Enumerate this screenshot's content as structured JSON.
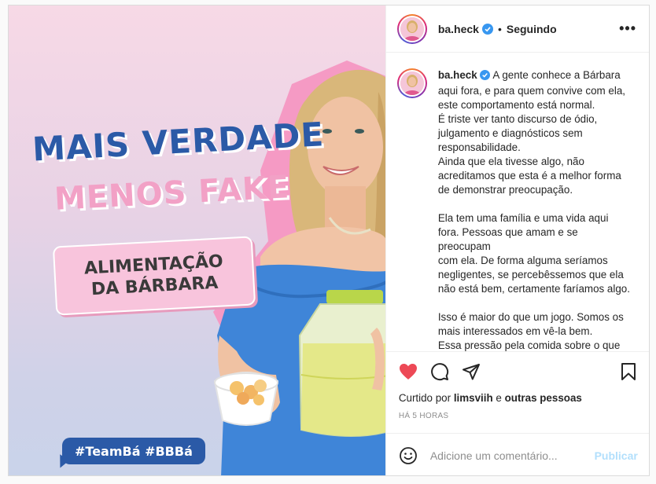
{
  "media": {
    "headline_1": "MAIS VERDADE",
    "headline_2": "MENOS FAKE",
    "box_line_1": "ALIMENTAÇÃO",
    "box_line_2": "DA BÁRBARA",
    "hashtag": "#TeamBá #BBBá"
  },
  "header": {
    "username": "ba.heck",
    "dot": "•",
    "follow_status": "Seguindo",
    "more_label": "•••"
  },
  "caption": {
    "username": "ba.heck",
    "lines": [
      "A gente conhece a Bárbara",
      "aqui fora, e para quem convive com ela,",
      "este comportamento está normal.",
      "É triste ver tanto discurso de ódio,",
      "julgamento e diagnósticos sem",
      "responsabilidade.",
      "Ainda que ela tivesse algo, não",
      "acreditamos que esta é a melhor forma",
      "de demonstrar preocupação.",
      "",
      "Ela tem uma família e uma vida aqui",
      "fora. Pessoas que amam e se preocupam",
      "com ela. De forma alguma seríamos",
      "negligentes, se percebêssemos que ela",
      "não está bem, certamente faríamos algo.",
      "",
      "Isso é maior do que um jogo. Somos os",
      "mais interessados em vê-la bem.",
      "Essa pressão pela comida sobre o que"
    ]
  },
  "likes": {
    "prefix": "Curtido por",
    "user": "limsviih",
    "connector": "e",
    "others": "outras pessoas"
  },
  "timestamp": "HÁ 5 HORAS",
  "comment_box": {
    "placeholder": "Adicione um comentário...",
    "publish_label": "Publicar"
  },
  "colors": {
    "like_red": "#ed4956",
    "verified_blue": "#3897f0",
    "headline_blue": "#2b5aa7",
    "headline_pink": "#f2a1c6",
    "publish_disabled": "#b2dffc"
  },
  "icons": [
    "heart-icon",
    "comment-icon",
    "share-icon",
    "bookmark-icon",
    "emoji-icon",
    "verified-icon",
    "more-options-icon"
  ]
}
